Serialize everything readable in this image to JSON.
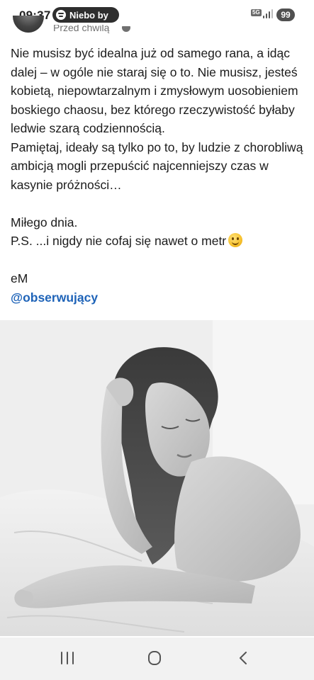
{
  "status_bar": {
    "time": "09:37",
    "media_text": "Niebo by",
    "network": "5G",
    "battery": "99"
  },
  "post_header": {
    "time_text": "Przed chwilą"
  },
  "post": {
    "paragraph1": "Nie musisz być idealna już od samego rana, a idąc dalej – w ogóle nie staraj się o to. Nie musisz, jesteś kobietą, niepowtarzalnym i zmysłowym uosobieniem boskiego chaosu, bez którego rzeczywistość byłaby ledwie szarą codziennością.",
    "paragraph2": "Pamiętaj, ideały są tylko po to, by ludzie z chorobliwą ambicją mogli przepuścić najcenniejszy czas w kasynie próżności…",
    "greeting": "Miłego dnia.",
    "ps": "P.S. ...i nigdy nie cofaj się nawet o metr",
    "signature": "eM",
    "mention": "@obserwujący"
  },
  "icons": {
    "spotify": "spotify-icon",
    "globe": "globe-icon",
    "emoji": "smiling-face-icon",
    "nav_recents": "recent-apps-icon",
    "nav_home": "home-icon",
    "nav_back": "back-icon"
  },
  "colors": {
    "mention": "#1e63b8",
    "text": "#1c1c1c",
    "nav_background": "#f2f2f2"
  }
}
